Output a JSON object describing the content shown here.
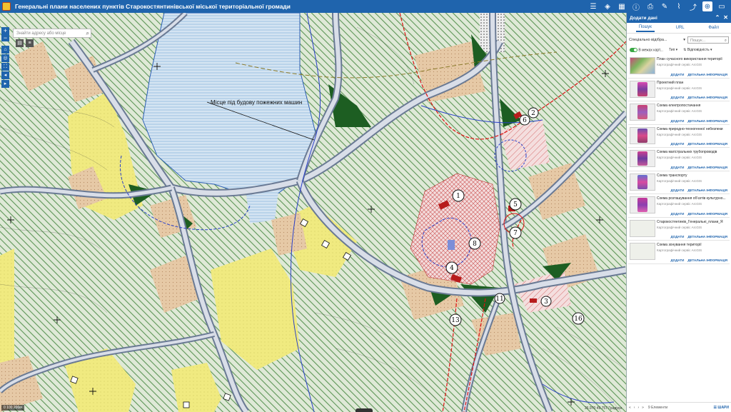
{
  "header": {
    "title": "Генеральні плани населених пунктів Старокостянтинівської міської територіальної громади",
    "tools": [
      "list-icon",
      "layers-icon",
      "grid-icon",
      "info-icon",
      "print-icon",
      "draw-icon",
      "measure-icon",
      "share-icon",
      "add-data-icon",
      "basemap-icon"
    ]
  },
  "map": {
    "search_placeholder": "Знайти адресу або місце",
    "annotation": "Місце під будову пожежних машин",
    "labels": {
      "site_1": "1",
      "site_2": "2",
      "site_3": "3",
      "site_4": "4",
      "site_5": "5",
      "site_6": "6",
      "site_7": "7",
      "site_8": "8",
      "site_11": "11",
      "site_13": "13",
      "site_16": "16"
    },
    "scale": "0    100    200м",
    "coords": "26.970 49.757 Градуси"
  },
  "panel": {
    "title": "Додати дані",
    "tabs": [
      "Пошук",
      "URL",
      "Файл"
    ],
    "source": "Спеціально відібра...",
    "search_placeholder": "Пошук...",
    "extent_label": "В межах карт...",
    "type_label": "Тип",
    "relevance_label": "Відповідність",
    "items": [
      {
        "name": "План сучасного використання території",
        "type": "Картографічний сервіс ArcGIS",
        "thumb": "wide"
      },
      {
        "name": "Проектний план",
        "type": "Картографічний сервіс ArcGIS",
        "thumb": "book"
      },
      {
        "name": "Схема електропостачання",
        "type": "Картографічний сервіс ArcGIS",
        "thumb": "book"
      },
      {
        "name": "Схема природно-техногенної небезпеки",
        "type": "Картографічний сервіс ArcGIS",
        "thumb": "book"
      },
      {
        "name": "Схема магістральних трубопроводів",
        "type": "Картографічний сервіс ArcGIS",
        "thumb": "book"
      },
      {
        "name": "Схема транспорту",
        "type": "Картографічний сервіс ArcGIS",
        "thumb": "book"
      },
      {
        "name": "Схема розташування об'єктів культурно...",
        "type": "Картографічний сервіс ArcGIS",
        "thumb": "book"
      },
      {
        "name": "Старокостянтинів_Генеральні_плани_Я",
        "type": "Картографічний сервіс ArcGIS",
        "thumb": "pale"
      },
      {
        "name": "Схема зонування території",
        "type": "Картографічний сервіс ArcGIS",
        "thumb": "pale"
      }
    ],
    "add_label": "ДОДАТИ",
    "details_label": "ДЕТАЛЬНА ІНФОРМАЦІЯ",
    "footer_count": "9 Елементи",
    "done_label": "ШАРИ"
  },
  "colors": {
    "header": "#1f64ad",
    "water": "#b9d3ea",
    "residential": "#f0d27a",
    "field": "#dfe9d7",
    "road": "#9aa6b8",
    "forest": "#1d5e22"
  }
}
